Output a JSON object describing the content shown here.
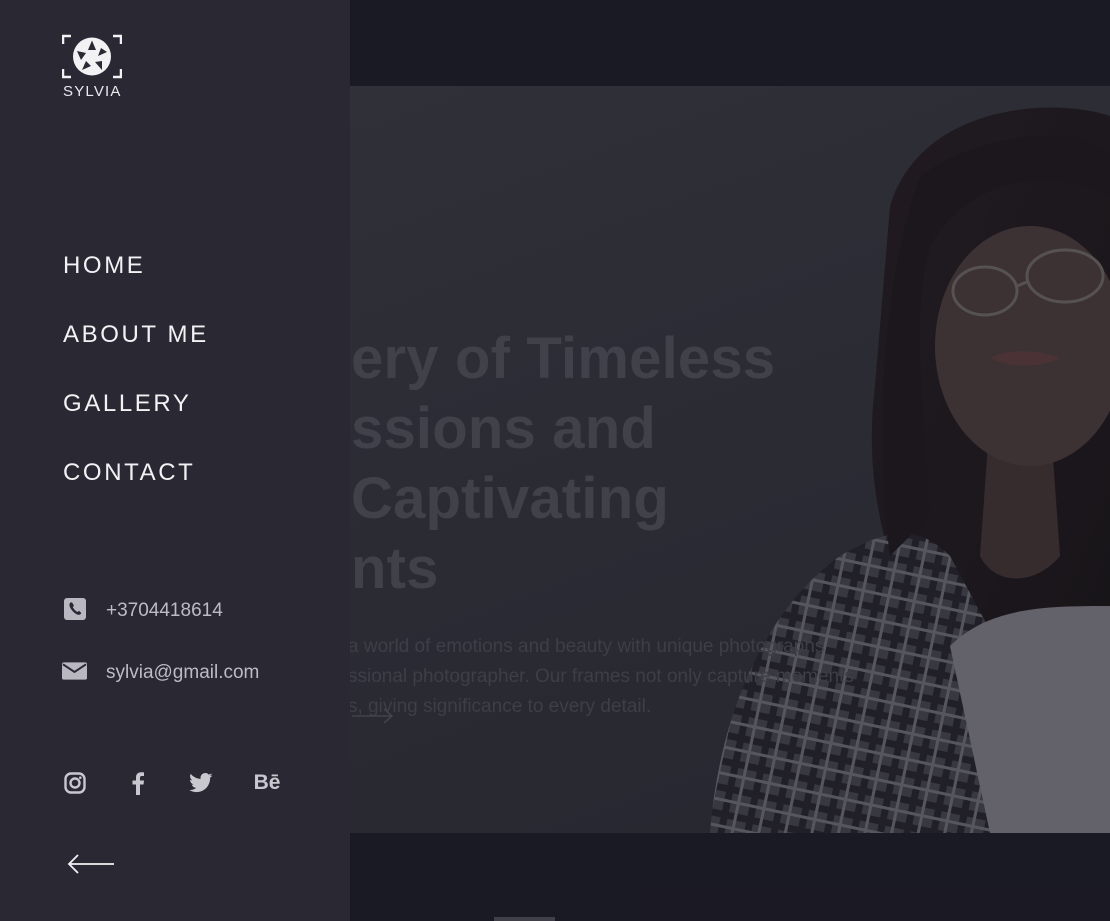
{
  "brand": {
    "name": "SYLVIA"
  },
  "menu": {
    "items": [
      {
        "label": "HOME"
      },
      {
        "label": "ABOUT ME"
      },
      {
        "label": "GALLERY"
      },
      {
        "label": "CONTACT"
      }
    ]
  },
  "contact": {
    "phone": "+3704418614",
    "email": "sylvia@gmail.com"
  },
  "hero": {
    "title_line1": "ery of Timeless",
    "title_line2": "ssions and Captivating",
    "title_line3": "nts",
    "desc_line1": "a world of emotions and beauty with unique photographs",
    "desc_line2": "ssional photographer. Our frames not only capture moments",
    "desc_line3": "s, giving significance to every detail."
  },
  "socials": [
    {
      "icon": "instagram-icon"
    },
    {
      "icon": "facebook-icon"
    },
    {
      "icon": "twitter-icon"
    },
    {
      "icon": "behance-icon",
      "label": "Bē"
    }
  ],
  "icons": {
    "phone": "phone-icon",
    "email": "envelope-icon",
    "back": "arrow-left-icon",
    "hero_cta": "arrow-right-icon"
  },
  "colors": {
    "menu_bg": "#292833",
    "page_bg": "#201f29",
    "hero_bg": "#3b3b44",
    "menu_text": "#f2f2f5",
    "contact_text": "#bdbcc4"
  }
}
